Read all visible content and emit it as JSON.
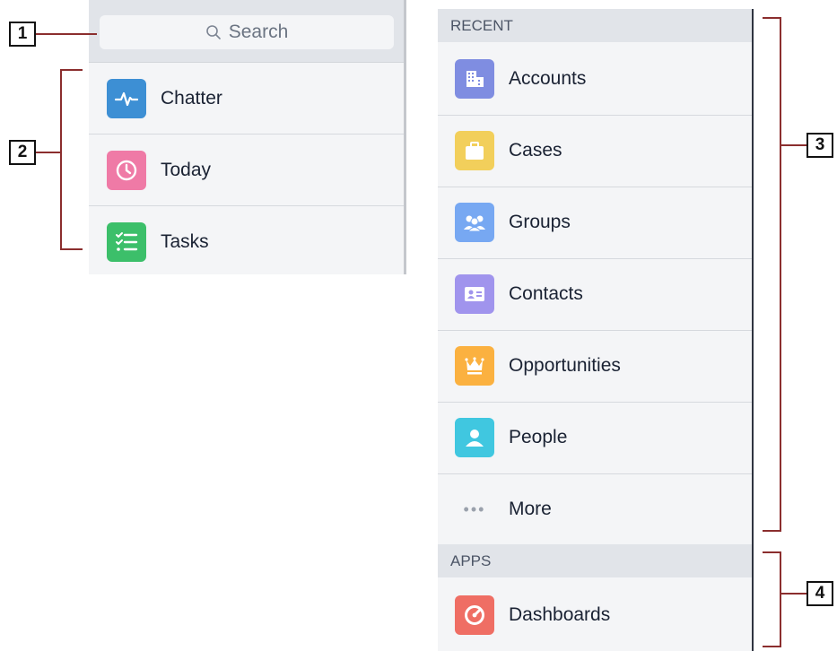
{
  "left_panel": {
    "search": {
      "placeholder": "Search"
    },
    "items": [
      {
        "label": "Chatter",
        "icon": "chatter-pulse-icon",
        "color": "#3d8fd4"
      },
      {
        "label": "Today",
        "icon": "clock-icon",
        "color": "#ef7aa6"
      },
      {
        "label": "Tasks",
        "icon": "checklist-icon",
        "color": "#3cbf6a"
      }
    ]
  },
  "right_panel": {
    "recent_header": "RECENT",
    "recent_items": [
      {
        "label": "Accounts",
        "icon": "building-icon",
        "color": "#7f8de1"
      },
      {
        "label": "Cases",
        "icon": "briefcase-icon",
        "color": "#f2cf5b"
      },
      {
        "label": "Groups",
        "icon": "group-icon",
        "color": "#77a8f2"
      },
      {
        "label": "Contacts",
        "icon": "contact-card-icon",
        "color": "#a094ed"
      },
      {
        "label": "Opportunities",
        "icon": "crown-icon",
        "color": "#fbb140"
      },
      {
        "label": "People",
        "icon": "person-icon",
        "color": "#40c7e0"
      }
    ],
    "more_label": "More",
    "apps_header": "APPS",
    "app_items": [
      {
        "label": "Dashboards",
        "icon": "gauge-icon",
        "color": "#ef6e64"
      }
    ]
  },
  "callouts": [
    "1",
    "2",
    "3",
    "4"
  ]
}
